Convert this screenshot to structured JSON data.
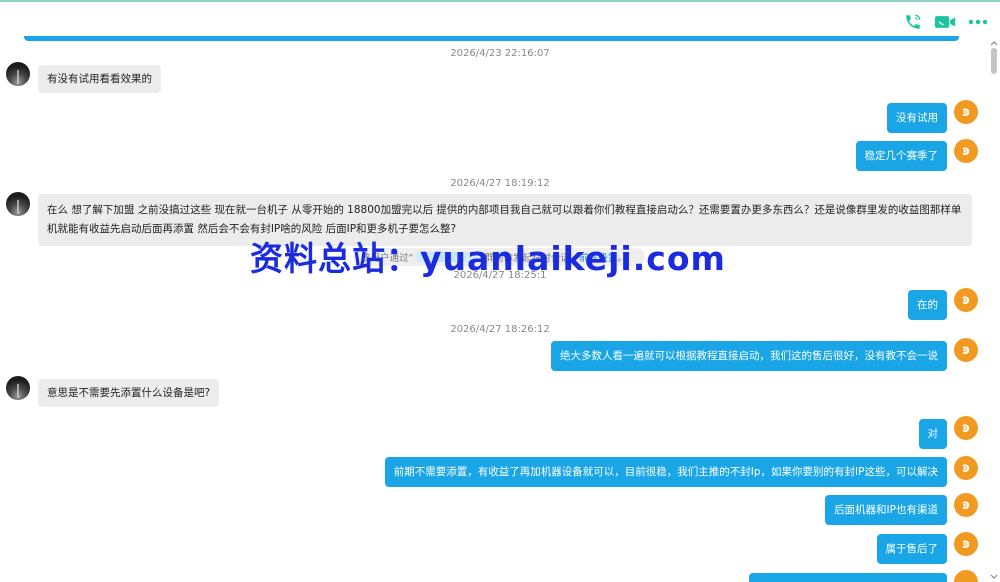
{
  "header": {
    "icons": [
      "phone-icon",
      "video-call-icon",
      "more-icon"
    ],
    "accent_color": "#1cc4a0"
  },
  "messages": [
    {
      "kind": "time",
      "text": "2026/4/23 22:16:07"
    },
    {
      "kind": "left",
      "text": "有没有试用看看效果的"
    },
    {
      "kind": "right",
      "text": "没有试用"
    },
    {
      "kind": "right",
      "text": "稳定几个赛季了"
    },
    {
      "kind": "time",
      "text": "2026/4/27 18:19:12"
    },
    {
      "kind": "left",
      "text": "在么 想了解下加盟 之前没搞过这些 现在就一台机子 从零开始的 18800加盟完以后 提供的内部项目我自己就可以跟着你们教程直接启动么？还需要置办更多东西么？还是说像群里发的收益图那样单机就能有收益先启动后面再添置 然后会不会有封IP啥的风险 后面IP和更多机子要怎么整?"
    },
    {
      "kind": "time",
      "text": "2026/4/27 18:25:1"
    },
    {
      "kind": "right",
      "text": "在的"
    },
    {
      "kind": "time",
      "text": "2026/4/27 18:26:12"
    },
    {
      "kind": "right",
      "text": "绝大多数人看一遍就可以根据教程直接启动，我们这的售后很好，没有教不会一说"
    },
    {
      "kind": "left",
      "text": "意思是不需要先添置什么设备是吧?"
    },
    {
      "kind": "right",
      "text": "对"
    },
    {
      "kind": "right",
      "text": "前期不需要添置，有收益了再加机器设备就可以，目前很稳，我们主推的不封Ip，如果你要别的有封IP这些，可以解决"
    },
    {
      "kind": "right",
      "text": "后面机器和IP也有渠道"
    },
    {
      "kind": "right",
      "text": "属于售后了"
    }
  ],
  "system_notice": {
    "prefix": "该用户通过“",
    "quote_mark": "”",
    "middle": "群向你发起临时会话，",
    "link": "前往设置",
    "suffix": "。"
  },
  "watermark": "资料总站：yuanlaikeji.com",
  "avatar_right_glyph": "ͽ",
  "colors": {
    "bubble_self": "#1aa5e6",
    "bubble_other": "#ececec",
    "avatar_self": "#f19a22",
    "watermark": "#1b2be0"
  }
}
